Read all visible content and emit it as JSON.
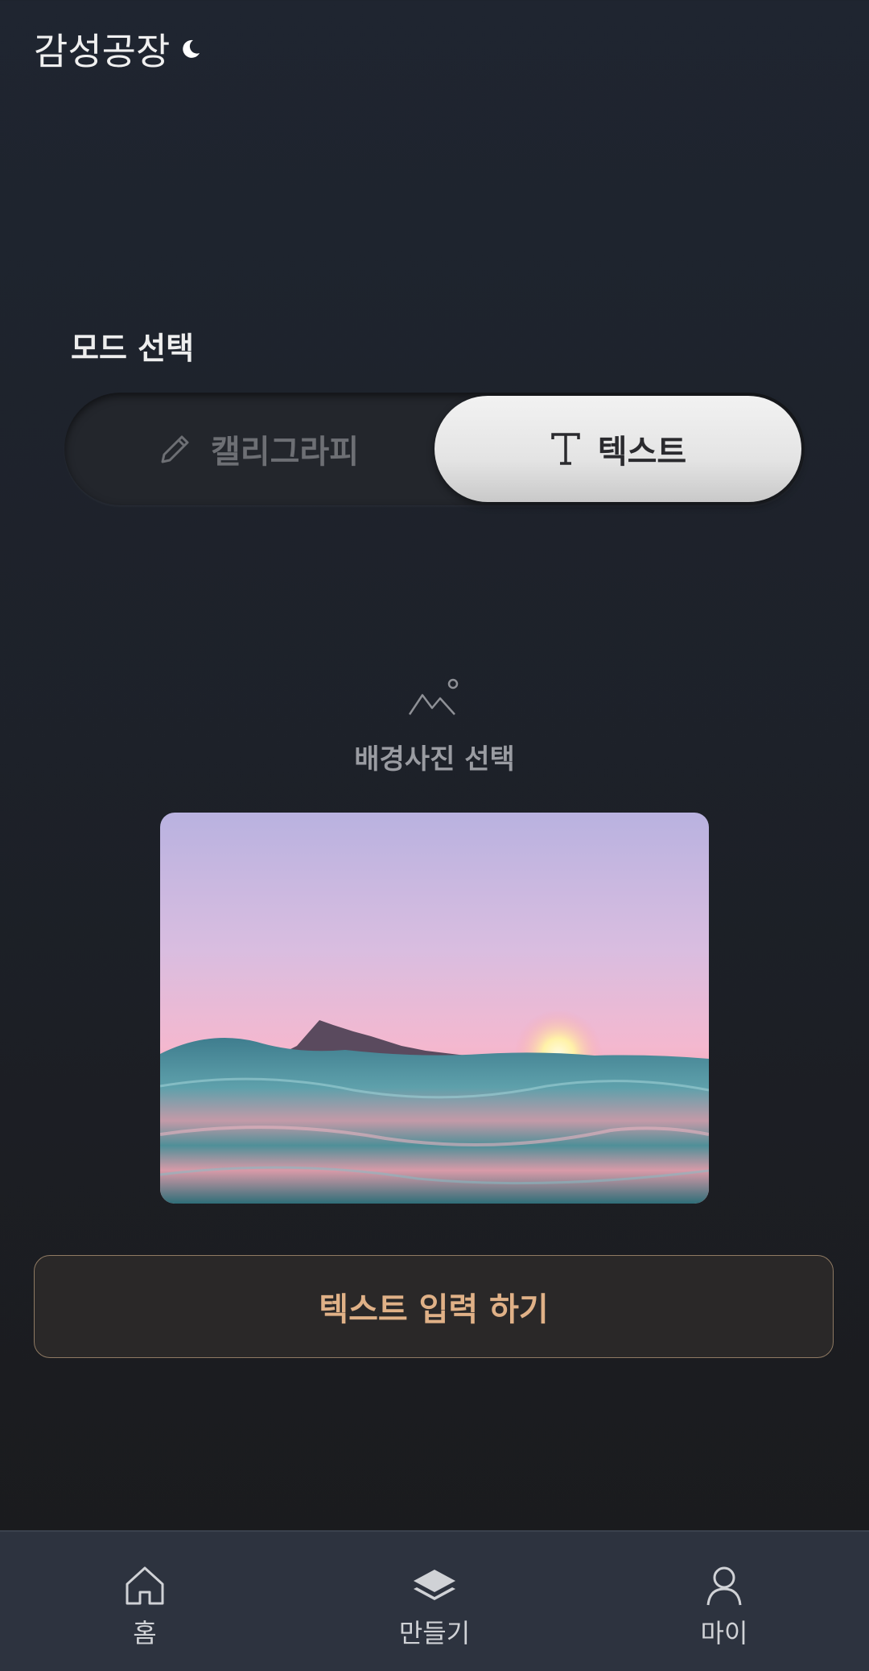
{
  "header": {
    "app_title": "감성공장",
    "moon_icon": "crescent-moon-icon"
  },
  "mode": {
    "label": "모드 선택",
    "options": [
      {
        "label": "캘리그라피",
        "icon": "pencil-icon",
        "selected": false
      },
      {
        "label": "텍스트",
        "icon": "text-t-icon",
        "selected": true
      }
    ]
  },
  "background": {
    "icon": "mountain-icon",
    "label": "배경사진 선택"
  },
  "action": {
    "text_input_label": "텍스트 입력 하기"
  },
  "bottom_nav": {
    "items": [
      {
        "label": "홈",
        "icon": "home-icon"
      },
      {
        "label": "만들기",
        "icon": "layers-icon"
      },
      {
        "label": "마이",
        "icon": "user-icon"
      }
    ]
  },
  "colors": {
    "accent": "#e0b187",
    "nav_bg": "#2d333f",
    "page_bg_top": "#1f2530",
    "selected_pill": "#ececec"
  }
}
